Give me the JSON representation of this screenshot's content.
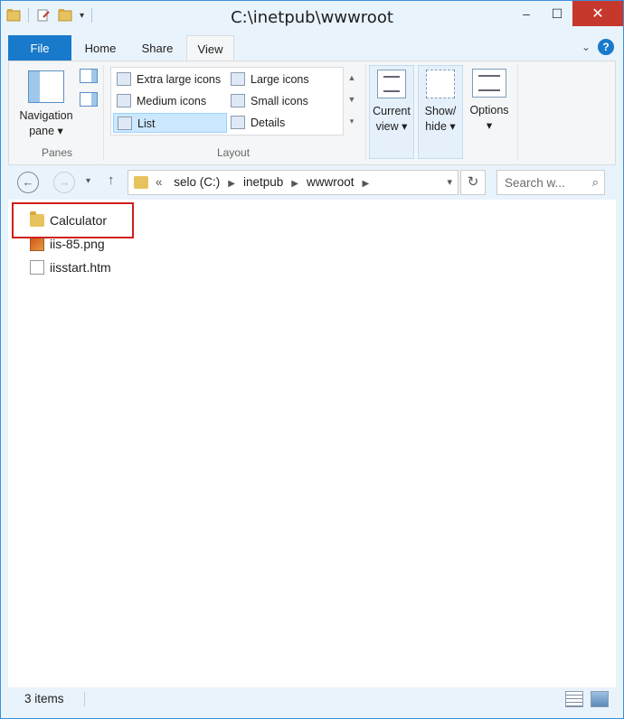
{
  "window": {
    "title": "C:\\inetpub\\wwwroot",
    "controls": {
      "minimize": "–",
      "maximize": "☐",
      "close": "✕"
    }
  },
  "ribbon": {
    "tabs": [
      {
        "label": "File"
      },
      {
        "label": "Home"
      },
      {
        "label": "Share"
      },
      {
        "label": "View",
        "active": true
      }
    ],
    "help_label": "?",
    "panes": {
      "group_label": "Panes",
      "navigation_pane": {
        "line1": "Navigation",
        "line2": "pane ▾"
      }
    },
    "layout": {
      "group_label": "Layout",
      "items": [
        {
          "label": "Extra large icons"
        },
        {
          "label": "Large icons"
        },
        {
          "label": "Medium icons"
        },
        {
          "label": "Small icons"
        },
        {
          "label": "List",
          "selected": true
        },
        {
          "label": "Details"
        }
      ]
    },
    "current_view": {
      "line1": "Current",
      "line2": "view ▾"
    },
    "show_hide": {
      "line1": "Show/",
      "line2": "hide ▾"
    },
    "options": {
      "line1": "Options",
      "line2": "▾"
    }
  },
  "address_bar": {
    "back": "←",
    "forward": "→",
    "recent": "▾",
    "up": "↑",
    "overflow": "«",
    "crumbs": [
      {
        "label": "selo (C:)"
      },
      {
        "label": "inetpub"
      },
      {
        "label": "wwwroot"
      }
    ],
    "dropdown": "▾",
    "refresh": "↻",
    "search_placeholder": "Search w...",
    "search_icon": "⌕"
  },
  "files": [
    {
      "name": "Calculator",
      "type": "folder",
      "icon": "folder-icon"
    },
    {
      "name": "iis-85.png",
      "type": "image",
      "icon": "png-file-icon"
    },
    {
      "name": "iisstart.htm",
      "type": "document",
      "icon": "htm-file-icon"
    }
  ],
  "status_bar": {
    "item_count": "3 items"
  },
  "colors": {
    "accent": "#1979ca",
    "close": "#c7382c",
    "highlight": "#d01f1f",
    "selected": "#cce8ff"
  }
}
